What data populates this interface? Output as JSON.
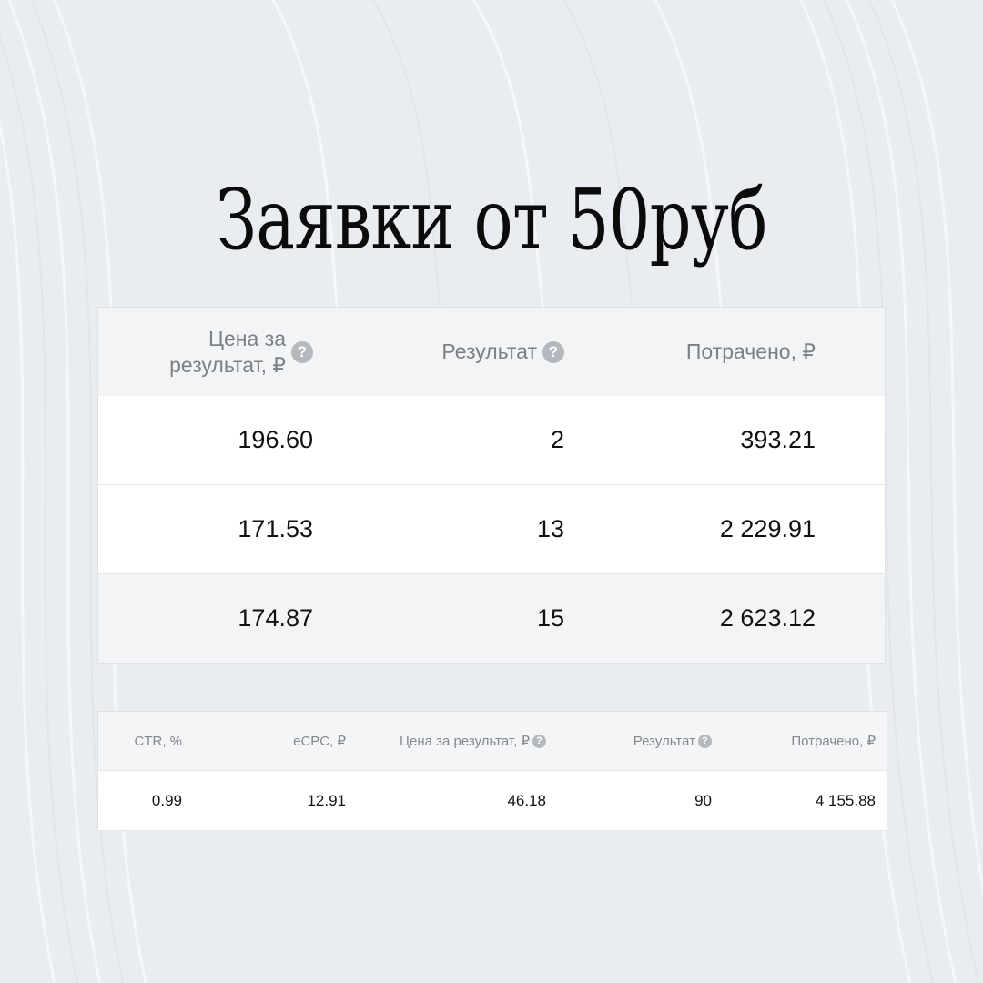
{
  "title": "Заявки от 50руб",
  "table1": {
    "headers": [
      "Цена за результат, ₽",
      "Результат",
      "Потрачено, ₽"
    ],
    "rows": [
      [
        "196.60",
        "2",
        "393.21"
      ],
      [
        "171.53",
        "13",
        "2 229.91"
      ],
      [
        "174.87",
        "15",
        "2 623.12"
      ]
    ]
  },
  "table2": {
    "headers": [
      "CTR, %",
      "eCPC, ₽",
      "Цена за результат, ₽",
      "Результат",
      "Потрачено, ₽"
    ],
    "rows": [
      [
        "0.99",
        "12.91",
        "46.18",
        "90",
        "4 155.88"
      ]
    ]
  },
  "icons": {
    "help_glyph": "?"
  },
  "colors": {
    "background": "#e9edf1",
    "header_text": "#7b8089",
    "cell_text": "#111111",
    "help_icon": "#b4b9c0"
  }
}
